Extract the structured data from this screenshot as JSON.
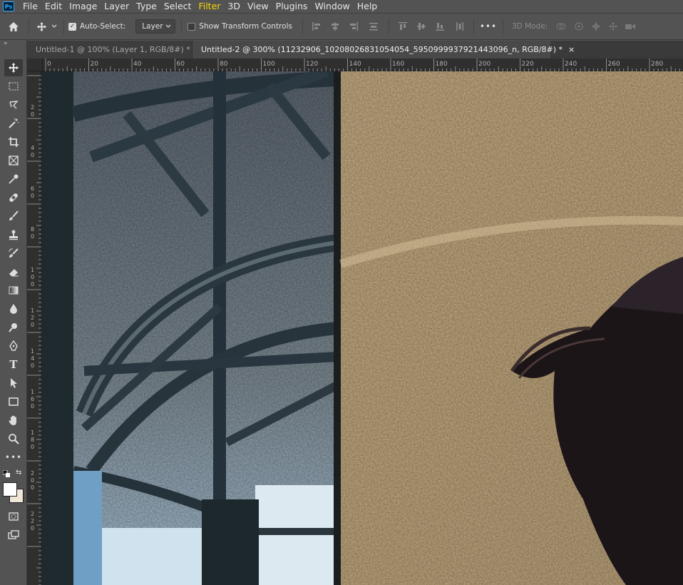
{
  "app": {
    "logo_text": "Ps"
  },
  "menu": [
    "File",
    "Edit",
    "Image",
    "Layer",
    "Type",
    "Select",
    "Filter",
    "3D",
    "View",
    "Plugins",
    "Window",
    "Help"
  ],
  "menu_active": "Filter",
  "options": {
    "auto_select_label": "Auto-Select:",
    "auto_select_checked": true,
    "layer_dropdown": "Layer",
    "transform_label": "Show Transform Controls",
    "transform_checked": false,
    "more_label": "•••",
    "mode_label": "3D Mode:"
  },
  "tabs": [
    {
      "label": "Untitled-1 @ 100% (Layer 1, RGB/8#) *",
      "active": false,
      "close": "×"
    },
    {
      "label": "Untitled-2 @ 300% (11232906_10208026831054054_5950999937921443096_n, RGB/8#) *",
      "active": true,
      "close": "×"
    }
  ],
  "ruler_top": [
    "0",
    "20",
    "40",
    "60",
    "80",
    "100",
    "120",
    "140",
    "160",
    "180",
    "200",
    "220",
    "240",
    "260",
    "280"
  ],
  "ruler_left": [
    "2",
    "0",
    "4",
    "0",
    "6",
    "0",
    "8",
    "0",
    "1\n0\n0",
    "1\n2\n0",
    "1\n4\n0",
    "1\n6\n0",
    "1\n8\n0",
    "2\n0\n0",
    "2\n2\n0"
  ],
  "tools": [
    "move-icon",
    "marquee-icon",
    "lasso-icon",
    "magic-wand-icon",
    "crop-icon",
    "frame-icon",
    "eyedropper-icon",
    "healing-icon",
    "brush-icon",
    "stamp-icon",
    "history-brush-icon",
    "eraser-icon",
    "gradient-icon",
    "blur-icon",
    "dodge-icon",
    "pen-icon",
    "type-icon",
    "path-select-icon",
    "rectangle-icon",
    "hand-icon",
    "zoom-icon",
    "more-tools-icon"
  ],
  "colors": {
    "accent_menu": "#f5d800",
    "foreground": "#ffffff",
    "background": "#f0e6d8"
  }
}
